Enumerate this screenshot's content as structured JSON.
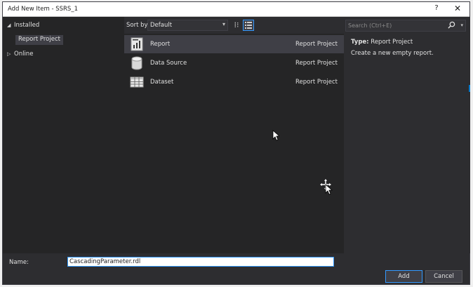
{
  "window": {
    "title": "Add New Item - SSRS_1",
    "help_glyph": "?",
    "close_glyph": "✕"
  },
  "tree": {
    "installed_label": "Installed",
    "installed_arrow": "◢",
    "report_project_label": "Report Project",
    "online_label": "Online",
    "online_arrow": "▷"
  },
  "toolbar": {
    "sort_by_label": "Sort by:",
    "sort_value": "Default",
    "sort_chevron": "▾",
    "grid_view_glyph": "⁞⁝"
  },
  "templates": [
    {
      "name": "Report",
      "category": "Report Project",
      "icon": "report-icon",
      "selected": true
    },
    {
      "name": "Data Source",
      "category": "Report Project",
      "icon": "data-source-icon",
      "selected": false
    },
    {
      "name": "Dataset",
      "category": "Report Project",
      "icon": "dataset-icon",
      "selected": false
    }
  ],
  "details": {
    "search_placeholder": "Search (Ctrl+E)",
    "search_chevron": "▾",
    "type_label": "Type:",
    "type_value": "Report Project",
    "description": "Create a new empty report."
  },
  "footer": {
    "name_label": "Name:",
    "name_value": "CascadingParameter.rdl",
    "add_label": "Add",
    "cancel_label": "Cancel"
  },
  "colors": {
    "background": "#2d2d30",
    "panel": "#252526",
    "selection": "#3f3f46",
    "accent": "#3399ff"
  }
}
